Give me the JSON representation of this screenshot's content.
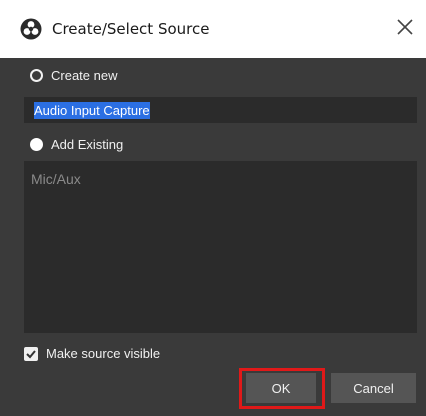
{
  "window": {
    "title": "Create/Select Source"
  },
  "create_new": {
    "label": "Create new",
    "value": "Audio Input Capture",
    "selected": false
  },
  "add_existing": {
    "label": "Add Existing",
    "selected": true
  },
  "sources": [
    "Mic/Aux"
  ],
  "make_visible": {
    "label": "Make source visible",
    "checked": true
  },
  "buttons": {
    "ok": "OK",
    "cancel": "Cancel"
  },
  "colors": {
    "background": "#3a3a3a",
    "highlight": "#e01919",
    "selection": "#2b6fe3"
  }
}
